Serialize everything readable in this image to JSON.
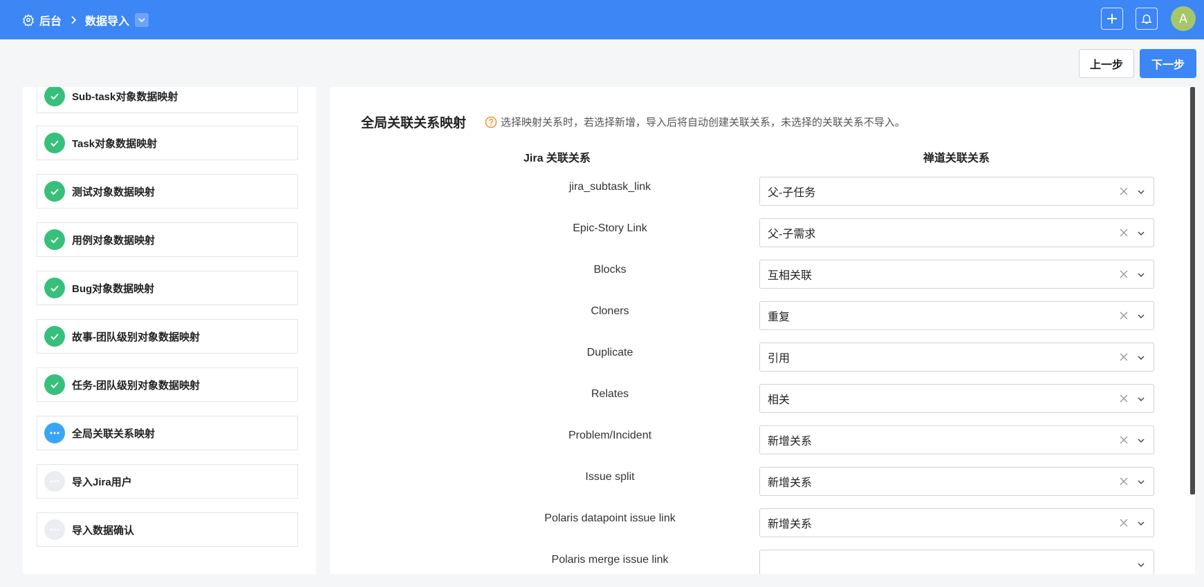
{
  "header": {
    "breadcrumb_root": "后台",
    "breadcrumb_current": "数据导入",
    "avatar_letter": "A",
    "accent": "#3c86f6"
  },
  "actions": {
    "prev_label": "上一步",
    "next_label": "下一步"
  },
  "steps": [
    {
      "label": "Sub-task对象数据映射",
      "status": "done"
    },
    {
      "label": "Task对象数据映射",
      "status": "done"
    },
    {
      "label": "测试对象数据映射",
      "status": "done"
    },
    {
      "label": "用例对象数据映射",
      "status": "done"
    },
    {
      "label": "Bug对象数据映射",
      "status": "done"
    },
    {
      "label": "故事-团队级别对象数据映射",
      "status": "done"
    },
    {
      "label": "任务-团队级别对象数据映射",
      "status": "done"
    },
    {
      "label": "全局关联关系映射",
      "status": "active"
    },
    {
      "label": "导入Jira用户",
      "status": "pending"
    },
    {
      "label": "导入数据确认",
      "status": "pending"
    }
  ],
  "main": {
    "title": "全局关联关系映射",
    "hint": "选择映射关系时，若选择新增，导入后将自动创建关联关系，未选择的关联关系不导入。",
    "col_jira": "Jira 关联关系",
    "col_zendao": "禅道关联关系",
    "rows": [
      {
        "jira": "jira_subtask_link",
        "value": "父-子任务"
      },
      {
        "jira": "Epic-Story Link",
        "value": "父-子需求"
      },
      {
        "jira": "Blocks",
        "value": "互相关联"
      },
      {
        "jira": "Cloners",
        "value": "重复"
      },
      {
        "jira": "Duplicate",
        "value": "引用"
      },
      {
        "jira": "Relates",
        "value": "相关"
      },
      {
        "jira": "Problem/Incident",
        "value": "新增关系"
      },
      {
        "jira": "Issue split",
        "value": "新增关系"
      },
      {
        "jira": "Polaris datapoint issue link",
        "value": "新增关系"
      },
      {
        "jira": "Polaris merge issue link",
        "value": ""
      }
    ]
  }
}
